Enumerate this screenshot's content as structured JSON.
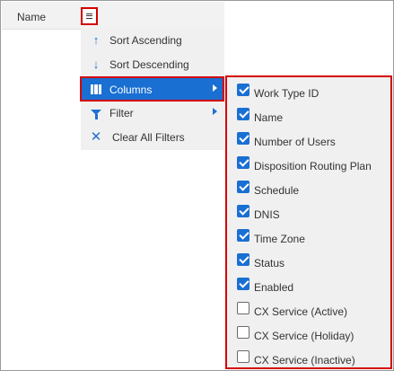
{
  "grid": {
    "column_header": "Name"
  },
  "column_menu": {
    "items": [
      {
        "label": "Sort Ascending",
        "icon": "arrow-up-icon"
      },
      {
        "label": "Sort Descending",
        "icon": "arrow-down-icon"
      },
      {
        "label": "Columns",
        "icon": "columns-icon",
        "selected": true
      },
      {
        "label": "Filter",
        "icon": "filter-icon"
      },
      {
        "label": "Clear All Filters",
        "icon": "close-icon"
      }
    ]
  },
  "columns_submenu": {
    "items": [
      {
        "label": "Work Type ID",
        "checked": true
      },
      {
        "label": "Name",
        "checked": true
      },
      {
        "label": "Number of Users",
        "checked": true
      },
      {
        "label": "Disposition Routing Plan",
        "checked": true
      },
      {
        "label": "Schedule",
        "checked": true
      },
      {
        "label": "DNIS",
        "checked": true
      },
      {
        "label": "Time Zone",
        "checked": true
      },
      {
        "label": "Status",
        "checked": true
      },
      {
        "label": "Enabled",
        "checked": true
      },
      {
        "label": "CX Service (Active)",
        "checked": false
      },
      {
        "label": "CX Service (Holiday)",
        "checked": false
      },
      {
        "label": "CX Service (Inactive)",
        "checked": false
      }
    ]
  },
  "colors": {
    "accent": "#1a6fd2",
    "highlight_border": "#d40000",
    "menu_bg": "#f0f0f0"
  }
}
